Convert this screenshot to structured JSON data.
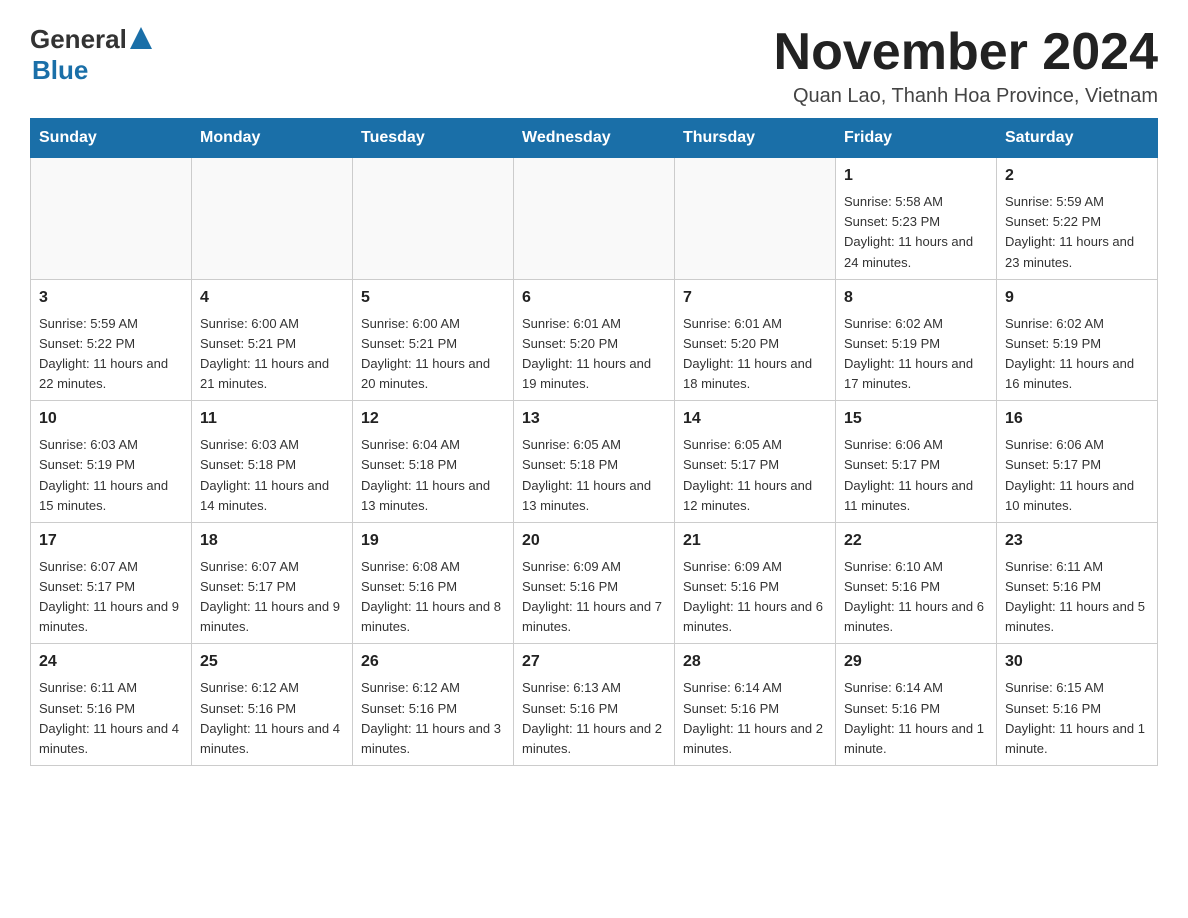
{
  "header": {
    "logo_general": "General",
    "logo_blue": "Blue",
    "month_title": "November 2024",
    "subtitle": "Quan Lao, Thanh Hoa Province, Vietnam"
  },
  "weekdays": [
    "Sunday",
    "Monday",
    "Tuesday",
    "Wednesday",
    "Thursday",
    "Friday",
    "Saturday"
  ],
  "weeks": [
    [
      {
        "day": "",
        "info": ""
      },
      {
        "day": "",
        "info": ""
      },
      {
        "day": "",
        "info": ""
      },
      {
        "day": "",
        "info": ""
      },
      {
        "day": "",
        "info": ""
      },
      {
        "day": "1",
        "info": "Sunrise: 5:58 AM\nSunset: 5:23 PM\nDaylight: 11 hours and 24 minutes."
      },
      {
        "day": "2",
        "info": "Sunrise: 5:59 AM\nSunset: 5:22 PM\nDaylight: 11 hours and 23 minutes."
      }
    ],
    [
      {
        "day": "3",
        "info": "Sunrise: 5:59 AM\nSunset: 5:22 PM\nDaylight: 11 hours and 22 minutes."
      },
      {
        "day": "4",
        "info": "Sunrise: 6:00 AM\nSunset: 5:21 PM\nDaylight: 11 hours and 21 minutes."
      },
      {
        "day": "5",
        "info": "Sunrise: 6:00 AM\nSunset: 5:21 PM\nDaylight: 11 hours and 20 minutes."
      },
      {
        "day": "6",
        "info": "Sunrise: 6:01 AM\nSunset: 5:20 PM\nDaylight: 11 hours and 19 minutes."
      },
      {
        "day": "7",
        "info": "Sunrise: 6:01 AM\nSunset: 5:20 PM\nDaylight: 11 hours and 18 minutes."
      },
      {
        "day": "8",
        "info": "Sunrise: 6:02 AM\nSunset: 5:19 PM\nDaylight: 11 hours and 17 minutes."
      },
      {
        "day": "9",
        "info": "Sunrise: 6:02 AM\nSunset: 5:19 PM\nDaylight: 11 hours and 16 minutes."
      }
    ],
    [
      {
        "day": "10",
        "info": "Sunrise: 6:03 AM\nSunset: 5:19 PM\nDaylight: 11 hours and 15 minutes."
      },
      {
        "day": "11",
        "info": "Sunrise: 6:03 AM\nSunset: 5:18 PM\nDaylight: 11 hours and 14 minutes."
      },
      {
        "day": "12",
        "info": "Sunrise: 6:04 AM\nSunset: 5:18 PM\nDaylight: 11 hours and 13 minutes."
      },
      {
        "day": "13",
        "info": "Sunrise: 6:05 AM\nSunset: 5:18 PM\nDaylight: 11 hours and 13 minutes."
      },
      {
        "day": "14",
        "info": "Sunrise: 6:05 AM\nSunset: 5:17 PM\nDaylight: 11 hours and 12 minutes."
      },
      {
        "day": "15",
        "info": "Sunrise: 6:06 AM\nSunset: 5:17 PM\nDaylight: 11 hours and 11 minutes."
      },
      {
        "day": "16",
        "info": "Sunrise: 6:06 AM\nSunset: 5:17 PM\nDaylight: 11 hours and 10 minutes."
      }
    ],
    [
      {
        "day": "17",
        "info": "Sunrise: 6:07 AM\nSunset: 5:17 PM\nDaylight: 11 hours and 9 minutes."
      },
      {
        "day": "18",
        "info": "Sunrise: 6:07 AM\nSunset: 5:17 PM\nDaylight: 11 hours and 9 minutes."
      },
      {
        "day": "19",
        "info": "Sunrise: 6:08 AM\nSunset: 5:16 PM\nDaylight: 11 hours and 8 minutes."
      },
      {
        "day": "20",
        "info": "Sunrise: 6:09 AM\nSunset: 5:16 PM\nDaylight: 11 hours and 7 minutes."
      },
      {
        "day": "21",
        "info": "Sunrise: 6:09 AM\nSunset: 5:16 PM\nDaylight: 11 hours and 6 minutes."
      },
      {
        "day": "22",
        "info": "Sunrise: 6:10 AM\nSunset: 5:16 PM\nDaylight: 11 hours and 6 minutes."
      },
      {
        "day": "23",
        "info": "Sunrise: 6:11 AM\nSunset: 5:16 PM\nDaylight: 11 hours and 5 minutes."
      }
    ],
    [
      {
        "day": "24",
        "info": "Sunrise: 6:11 AM\nSunset: 5:16 PM\nDaylight: 11 hours and 4 minutes."
      },
      {
        "day": "25",
        "info": "Sunrise: 6:12 AM\nSunset: 5:16 PM\nDaylight: 11 hours and 4 minutes."
      },
      {
        "day": "26",
        "info": "Sunrise: 6:12 AM\nSunset: 5:16 PM\nDaylight: 11 hours and 3 minutes."
      },
      {
        "day": "27",
        "info": "Sunrise: 6:13 AM\nSunset: 5:16 PM\nDaylight: 11 hours and 2 minutes."
      },
      {
        "day": "28",
        "info": "Sunrise: 6:14 AM\nSunset: 5:16 PM\nDaylight: 11 hours and 2 minutes."
      },
      {
        "day": "29",
        "info": "Sunrise: 6:14 AM\nSunset: 5:16 PM\nDaylight: 11 hours and 1 minute."
      },
      {
        "day": "30",
        "info": "Sunrise: 6:15 AM\nSunset: 5:16 PM\nDaylight: 11 hours and 1 minute."
      }
    ]
  ]
}
